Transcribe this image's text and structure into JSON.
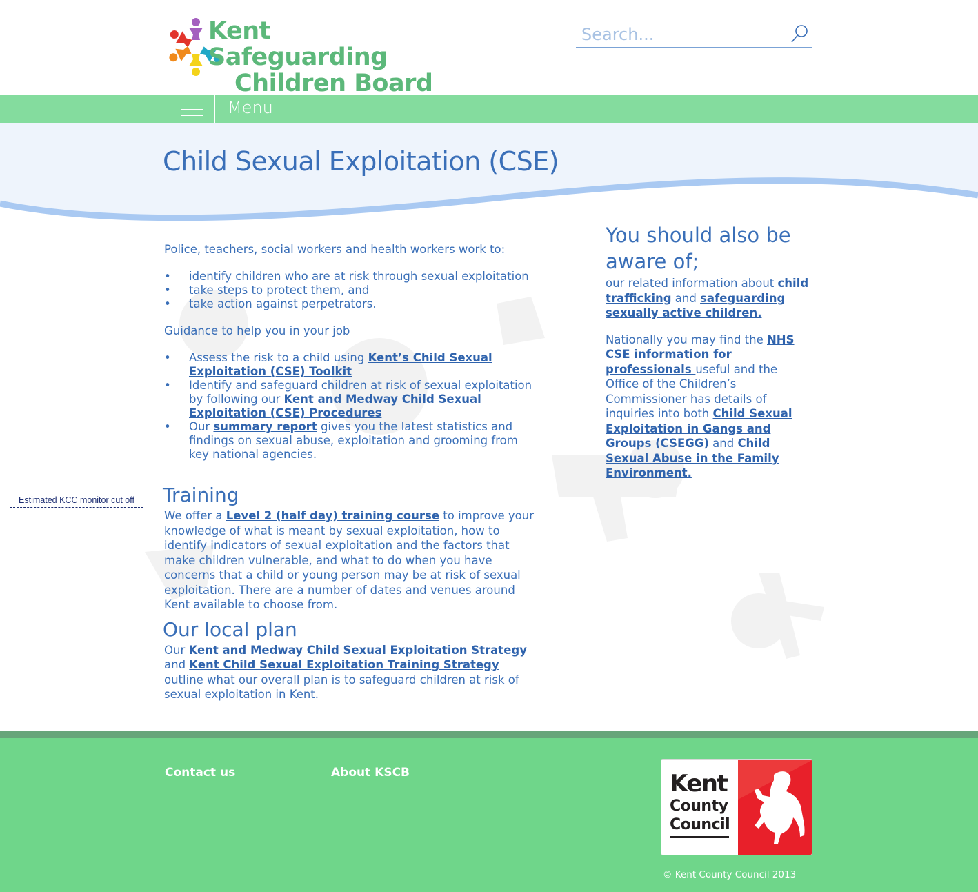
{
  "header": {
    "logo_line1": "Kent Safeguarding",
    "logo_line2": "Children Board",
    "search_placeholder": "Search..."
  },
  "menu": {
    "label": "Menu"
  },
  "page": {
    "title": "Child Sexual Exploitation (CSE)"
  },
  "main": {
    "intro": "Police, teachers, social workers and health workers work to:",
    "work_items": [
      "identify children who are at risk through sexual exploitation",
      "take steps to protect them, and",
      "take action against perpetrators."
    ],
    "guidance_intro": "Guidance to help you in your job",
    "guidance": {
      "item1_pre": "Assess the risk to a child using ",
      "item1_link": "Kent’s Child Sexual Exploitation (CSE) Toolkit",
      "item2_pre": "Identify and safeguard children at risk of sexual exploitation by  following our ",
      "item2_link": "Kent and Medway Child Sexual Exploitation (CSE) Procedures",
      "item3_pre": "Our ",
      "item3_link": "summary report",
      "item3_post": " gives you the latest statistics and findings on sexual abuse, exploitation and grooming from key national agencies."
    },
    "training": {
      "heading": "Training",
      "pre": "We offer a ",
      "link": "Level 2 (half day) training course",
      "post": " to improve your knowledge of what is meant by sexual exploitation, how to identify indicators of sexual exploitation and the factors that make children vulnerable, and what to do when you have concerns that a child or young person may be at risk of sexual exploitation. There are a number of dates and venues around Kent available to choose from."
    },
    "plan": {
      "heading": "Our local plan",
      "pre": "Our ",
      "link1": "Kent and Medway Child Sexual Exploitation Strategy",
      "mid": " and ",
      "link2": "Kent Child Sexual Exploitation Training Strategy",
      "post": " outline what our overall plan is to safeguard children at risk of sexual exploitation in Kent."
    }
  },
  "sidebar": {
    "heading": "You should also be aware of;",
    "p1_pre": " our related information about ",
    "p1_link1": "child trafficking",
    "p1_mid": " and ",
    "p1_link2": "safeguarding sexually active children. ",
    "p2_pre": "Nationally you may find the ",
    "p2_link1": "NHS CSE information for professionals ",
    "p2_mid1": "useful and the Office of the Children’s Commissioner has details of inquiries into both ",
    "p2_link2": "Child Sexual Exploitation in Gangs and Groups (CSEGG)",
    "p2_mid2": " and ",
    "p2_link3": "Child Sexual Abuse in the Family Environment."
  },
  "monitor_note": "Estimated KCC monitor cut off",
  "footer": {
    "contact_label": "Contact us",
    "about_label": "About KSCB",
    "kcc_line1": "Kent",
    "kcc_line2": "County",
    "kcc_line3": "Council",
    "copyright": "© Kent County Council 2013"
  },
  "colors": {
    "brand_green": "#5cb87a",
    "menu_green": "#84dc9e",
    "footer_green": "#6fd68a",
    "text_blue": "#3a6fb8",
    "band_blue": "#eef4fc",
    "wave_blue": "#a9c9f2",
    "kcc_red": "#e8202a"
  },
  "icons": [
    "logo-children-circle",
    "search-icon",
    "hamburger-icon",
    "kcc-horse-icon"
  ]
}
